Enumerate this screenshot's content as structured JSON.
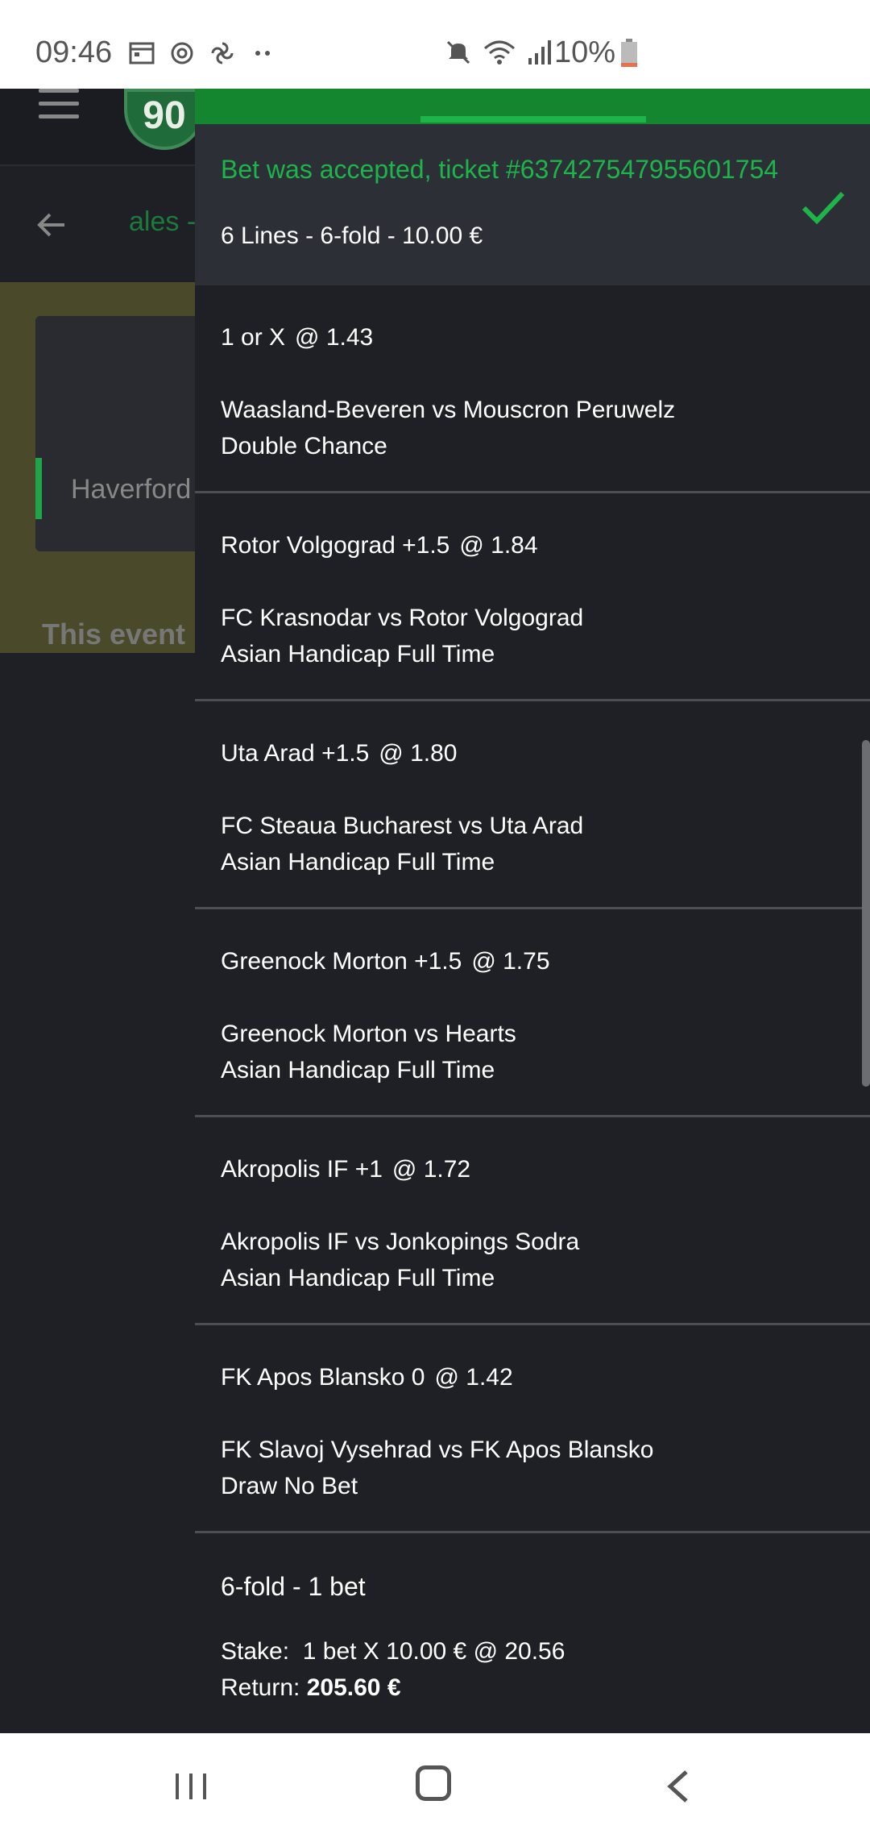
{
  "status_bar": {
    "time": "09:46",
    "battery": "10%",
    "icons": [
      "calendar-icon",
      "sync-icon",
      "fan-icon",
      "more-dots-icon",
      "mute-icon",
      "wifi-icon",
      "signal-icon",
      "battery-icon"
    ]
  },
  "background": {
    "logo_text": "90",
    "title_partial": "ales -",
    "card_text_partial": "Haverford",
    "event_text_partial": "This event i"
  },
  "confirmation": {
    "title": "Bet was accepted, ticket #637427547955601754",
    "subtitle": "6 Lines - 6-fold - 10.00 €"
  },
  "lines": [
    {
      "selection": "1 or X",
      "odds": "@ 1.43",
      "match": "Waasland-Beveren vs Mouscron Peruwelz",
      "market": "Double Chance"
    },
    {
      "selection": "Rotor Volgograd  +1.5",
      "odds": "@ 1.84",
      "match": "FC Krasnodar vs Rotor Volgograd",
      "market": "Asian Handicap Full Time"
    },
    {
      "selection": "Uta Arad  +1.5",
      "odds": "@ 1.80",
      "match": "FC Steaua Bucharest vs Uta Arad",
      "market": "Asian Handicap Full Time"
    },
    {
      "selection": "Greenock Morton  +1.5",
      "odds": "@ 1.75",
      "match": "Greenock Morton vs Hearts",
      "market": "Asian Handicap Full Time"
    },
    {
      "selection": "Akropolis IF  +1",
      "odds": "@ 1.72",
      "match": "Akropolis IF vs Jonkopings Sodra",
      "market": "Asian Handicap Full Time"
    },
    {
      "selection": "FK Apos Blansko  0",
      "odds": "@ 1.42",
      "match": "FK Slavoj Vysehrad vs FK Apos Blansko",
      "market": "Draw No Bet"
    }
  ],
  "summary": {
    "title": "6-fold - 1 bet",
    "stake_label": "Stake:",
    "stake_value": "1 bet X 10.00 €  @ 20.56",
    "return_label": "Return:",
    "return_value": "205.60 €"
  },
  "colors": {
    "accent_green": "#1db44a",
    "panel_bg": "#1f2026",
    "confirm_bg": "#2d2f37"
  }
}
